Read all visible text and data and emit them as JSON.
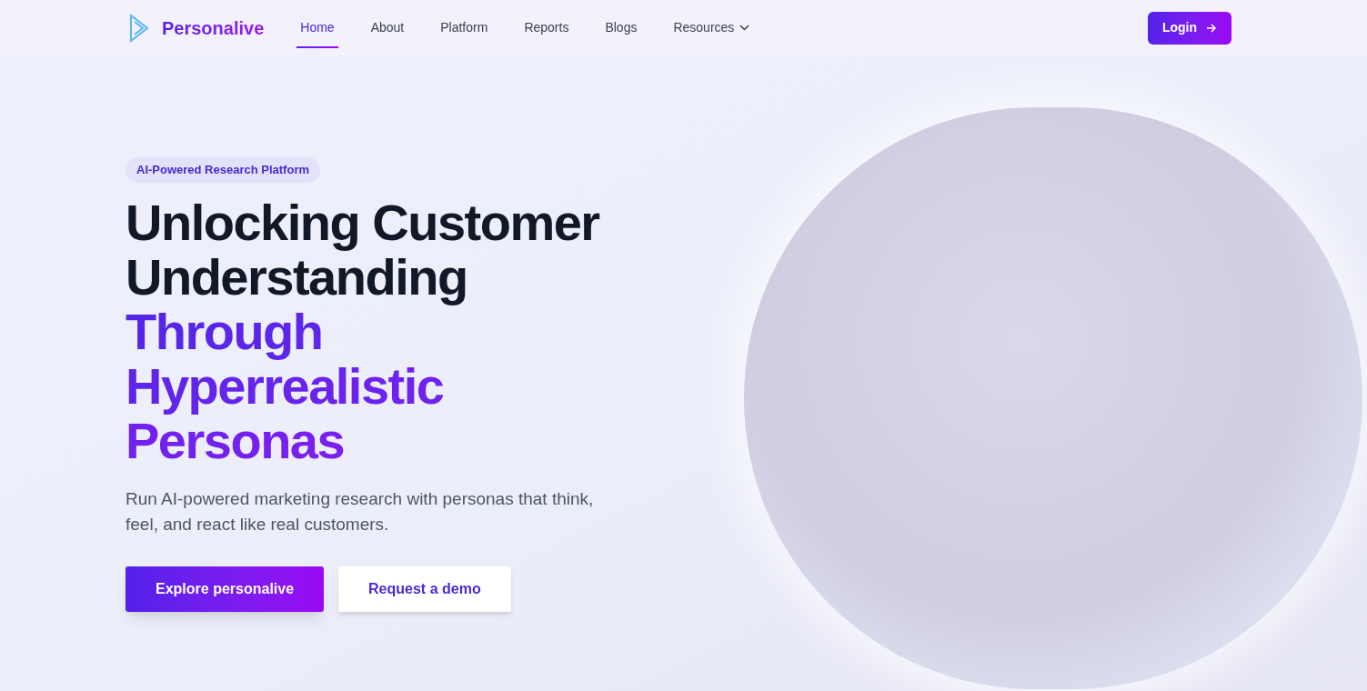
{
  "brand": {
    "name": "Personalive"
  },
  "nav": [
    {
      "label": "Home",
      "selected": true,
      "dropdown": false
    },
    {
      "label": "About",
      "selected": false,
      "dropdown": false
    },
    {
      "label": "Platform",
      "selected": false,
      "dropdown": false
    },
    {
      "label": "Reports",
      "selected": false,
      "dropdown": false
    },
    {
      "label": "Blogs",
      "selected": false,
      "dropdown": false
    },
    {
      "label": "Resources",
      "selected": false,
      "dropdown": true
    }
  ],
  "login": {
    "label": "Login"
  },
  "hero": {
    "badge": "AI-Powered Research Platform",
    "heading": "Unlocking Customer Understanding",
    "heading_highlight": "Through Hyperrealistic Personas",
    "subtitle": "Run AI-powered marketing research with personas that think, feel, and react like real customers.",
    "buttons": [
      {
        "label": "Explore personalive",
        "kind": "primary"
      },
      {
        "label": "Request a demo",
        "kind": "secondary"
      }
    ]
  }
}
